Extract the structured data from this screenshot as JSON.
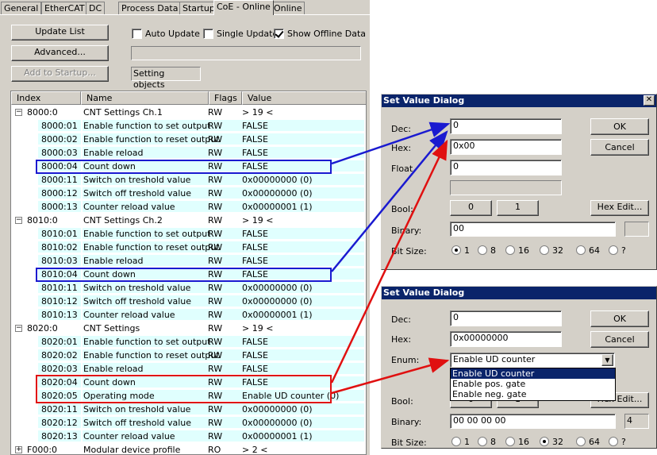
{
  "tabs": [
    "General",
    "EtherCAT",
    "DC",
    "Process Data",
    "Startup",
    "CoE - Online",
    "Online"
  ],
  "active_tab": "CoE - Online",
  "toolbar": {
    "update_list": "Update List",
    "advanced": "Advanced...",
    "add_to_startup": "Add to Startup...",
    "auto_update": "Auto Update",
    "single_update": "Single Update",
    "show_offline": "Show Offline Data",
    "status": "Setting objects"
  },
  "table": {
    "headers": [
      "Index",
      "Name",
      "Flags",
      "Value"
    ],
    "rows": [
      {
        "index": "8000:0",
        "name": "CNT Settings Ch.1",
        "flags": "RW",
        "value": "> 19 <",
        "group": true
      },
      {
        "index": "8000:01",
        "name": "Enable function to set output",
        "flags": "RW",
        "value": "FALSE"
      },
      {
        "index": "8000:02",
        "name": "Enable function to reset output",
        "flags": "RW",
        "value": "FALSE"
      },
      {
        "index": "8000:03",
        "name": "Enable reload",
        "flags": "RW",
        "value": "FALSE"
      },
      {
        "index": "8000:04",
        "name": "Count down",
        "flags": "RW",
        "value": "FALSE"
      },
      {
        "index": "8000:11",
        "name": "Switch on treshold value",
        "flags": "RW",
        "value": "0x00000000 (0)"
      },
      {
        "index": "8000:12",
        "name": "Switch off treshold value",
        "flags": "RW",
        "value": "0x00000000 (0)"
      },
      {
        "index": "8000:13",
        "name": "Counter reload value",
        "flags": "RW",
        "value": "0x00000001 (1)"
      },
      {
        "index": "8010:0",
        "name": "CNT Settings Ch.2",
        "flags": "RW",
        "value": "> 19 <",
        "group": true
      },
      {
        "index": "8010:01",
        "name": "Enable function to set output",
        "flags": "RW",
        "value": "FALSE"
      },
      {
        "index": "8010:02",
        "name": "Enable function to reset output",
        "flags": "RW",
        "value": "FALSE"
      },
      {
        "index": "8010:03",
        "name": "Enable reload",
        "flags": "RW",
        "value": "FALSE"
      },
      {
        "index": "8010:04",
        "name": "Count down",
        "flags": "RW",
        "value": "FALSE"
      },
      {
        "index": "8010:11",
        "name": "Switch on treshold value",
        "flags": "RW",
        "value": "0x00000000 (0)"
      },
      {
        "index": "8010:12",
        "name": "Switch off treshold value",
        "flags": "RW",
        "value": "0x00000000 (0)"
      },
      {
        "index": "8010:13",
        "name": "Counter reload value",
        "flags": "RW",
        "value": "0x00000001 (1)"
      },
      {
        "index": "8020:0",
        "name": "CNT Settings",
        "flags": "RW",
        "value": "> 19 <",
        "group": true
      },
      {
        "index": "8020:01",
        "name": "Enable function to set output",
        "flags": "RW",
        "value": "FALSE"
      },
      {
        "index": "8020:02",
        "name": "Enable function to reset output",
        "flags": "RW",
        "value": "FALSE"
      },
      {
        "index": "8020:03",
        "name": "Enable reload",
        "flags": "RW",
        "value": "FALSE"
      },
      {
        "index": "8020:04",
        "name": "Count down",
        "flags": "RW",
        "value": "FALSE"
      },
      {
        "index": "8020:05",
        "name": "Operating mode",
        "flags": "RW",
        "value": "Enable UD counter (0)"
      },
      {
        "index": "8020:11",
        "name": "Switch on treshold value",
        "flags": "RW",
        "value": "0x00000000 (0)"
      },
      {
        "index": "8020:12",
        "name": "Switch off treshold value",
        "flags": "RW",
        "value": "0x00000000 (0)"
      },
      {
        "index": "8020:13",
        "name": "Counter reload value",
        "flags": "RW",
        "value": "0x00000001 (1)"
      },
      {
        "index": "F000:0",
        "name": "Modular device profile",
        "flags": "RO",
        "value": "> 2 <",
        "group": true,
        "collapsed": true
      }
    ]
  },
  "dialog1": {
    "title": "Set Value Dialog",
    "dec_label": "Dec:",
    "dec": "0",
    "hex_label": "Hex:",
    "hex": "0x00",
    "float_label": "Float",
    "float": "0",
    "bool_label": "Bool:",
    "bool0": "0",
    "bool1": "1",
    "hex_edit": "Hex Edit...",
    "binary_label": "Binary:",
    "binary": "00",
    "bitsize_label": "Bit Size:",
    "bitsizes": [
      "1",
      "8",
      "16",
      "32",
      "64",
      "?"
    ],
    "ok": "OK",
    "cancel": "Cancel"
  },
  "dialog2": {
    "title": "Set Value Dialog",
    "dec_label": "Dec:",
    "dec": "0",
    "hex_label": "Hex:",
    "hex": "0x00000000",
    "enum_label": "Enum:",
    "enum": "Enable UD counter",
    "enum_options": [
      "Enable UD counter",
      "Enable pos. gate",
      "Enable neg. gate"
    ],
    "bool_label": "Bool:",
    "bool0": "0",
    "bool1": "1",
    "hex_edit": "Hex Edit...",
    "binary_label": "Binary:",
    "binary": "00 00 00 00",
    "binary_len": "4",
    "bitsize_label": "Bit Size:",
    "bitsizes": [
      "1",
      "8",
      "16",
      "32",
      "64",
      "?"
    ],
    "ok": "OK",
    "cancel": "Cancel"
  },
  "colors": {
    "blue": "#1a1ad0",
    "red": "#e01010",
    "highlight": "#e0fffe",
    "titlebar": "#0a246a"
  }
}
